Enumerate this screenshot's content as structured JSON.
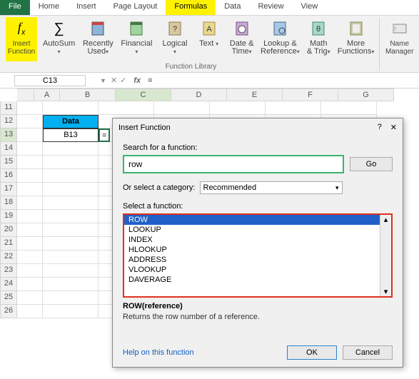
{
  "tabs": {
    "file": "File",
    "home": "Home",
    "insert": "Insert",
    "page": "Page Layout",
    "formulas": "Formulas",
    "data": "Data",
    "review": "Review",
    "view": "View"
  },
  "ribbon": {
    "insert_function": "Insert\nFunction",
    "autosum": "AutoSum",
    "recently": "Recently\nUsed",
    "financial": "Financial",
    "logical": "Logical",
    "text": "Text",
    "datetime": "Date &\nTime",
    "lookup": "Lookup &\nReference",
    "math": "Math\n& Trig",
    "more": "More\nFunctions",
    "name_mgr": "Name\nManager",
    "group_label": "Function Library"
  },
  "formula_bar": {
    "namebox": "C13",
    "value": "="
  },
  "grid": {
    "cols": [
      "A",
      "B",
      "C",
      "D",
      "E",
      "F",
      "G"
    ],
    "rows": [
      "11",
      "12",
      "13",
      "14",
      "15",
      "16",
      "17",
      "18",
      "19",
      "20",
      "21",
      "22",
      "23",
      "24",
      "25",
      "26"
    ],
    "header_cell": "Data",
    "data_cell": "B13",
    "cur_cell": "="
  },
  "dialog": {
    "title": "Insert Function",
    "search_label": "Search for a function:",
    "search_value": "row",
    "go": "Go",
    "cat_label": "Or select a category:",
    "cat_value": "Recommended",
    "select_label": "Select a function:",
    "fns": [
      "ROW",
      "LOOKUP",
      "INDEX",
      "HLOOKUP",
      "ADDRESS",
      "VLOOKUP",
      "DAVERAGE"
    ],
    "sig": "ROW(reference)",
    "desc": "Returns the row number of a reference.",
    "help": "Help on this function",
    "ok": "OK",
    "cancel": "Cancel"
  }
}
